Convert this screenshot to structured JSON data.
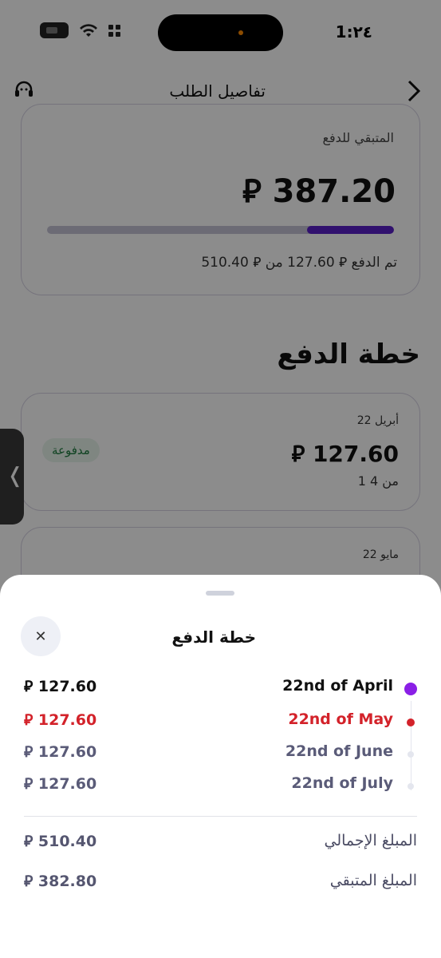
{
  "status_bar": {
    "time": "1:٢٤"
  },
  "nav": {
    "title": "تفاصيل الطلب",
    "back_icon": "chevron-right-icon",
    "support_icon": "headset-icon"
  },
  "remaining_card": {
    "label": "المتبقي للدفع",
    "amount": "⃁ 387.20",
    "progress_paid_fraction": 0.25,
    "paid_text": "تم الدفع ⃁ 127.60 من ⃁ 510.40"
  },
  "plan": {
    "heading": "خطة الدفع",
    "installments": [
      {
        "date": "22 أبريل",
        "amount": "⃁ 127.60",
        "count": "1 من 4",
        "status": "مدفوعة"
      },
      {
        "date": "22 مايو"
      }
    ]
  },
  "sheet": {
    "title": "خطة الدفع",
    "close_icon": "close-icon",
    "rows": [
      {
        "date": "22nd of April",
        "amount": "⃁ 127.60",
        "color": "#111111",
        "dot": "#8a1fe6"
      },
      {
        "date": "22nd of May",
        "amount": "⃁ 127.60",
        "color": "#d3222a",
        "dot": "#d3222a"
      },
      {
        "date": "22nd of June",
        "amount": "⃁ 127.60",
        "color": "#5a5b78",
        "dot": "#e4e6ee"
      },
      {
        "date": "22nd of July",
        "amount": "⃁ 127.60",
        "color": "#5a5b78",
        "dot": "#e4e6ee"
      }
    ],
    "total_label": "المبلغ الإجمالي",
    "total_value": "⃁ 510.40",
    "remaining_label": "المبلغ المتبقي",
    "remaining_value": "⃁ 382.80"
  },
  "colors": {
    "accent": "#5a1fc9",
    "overdue": "#d3222a",
    "paid_badge_bg": "#e8f5ec",
    "paid_badge_text": "#1e7a3e"
  }
}
